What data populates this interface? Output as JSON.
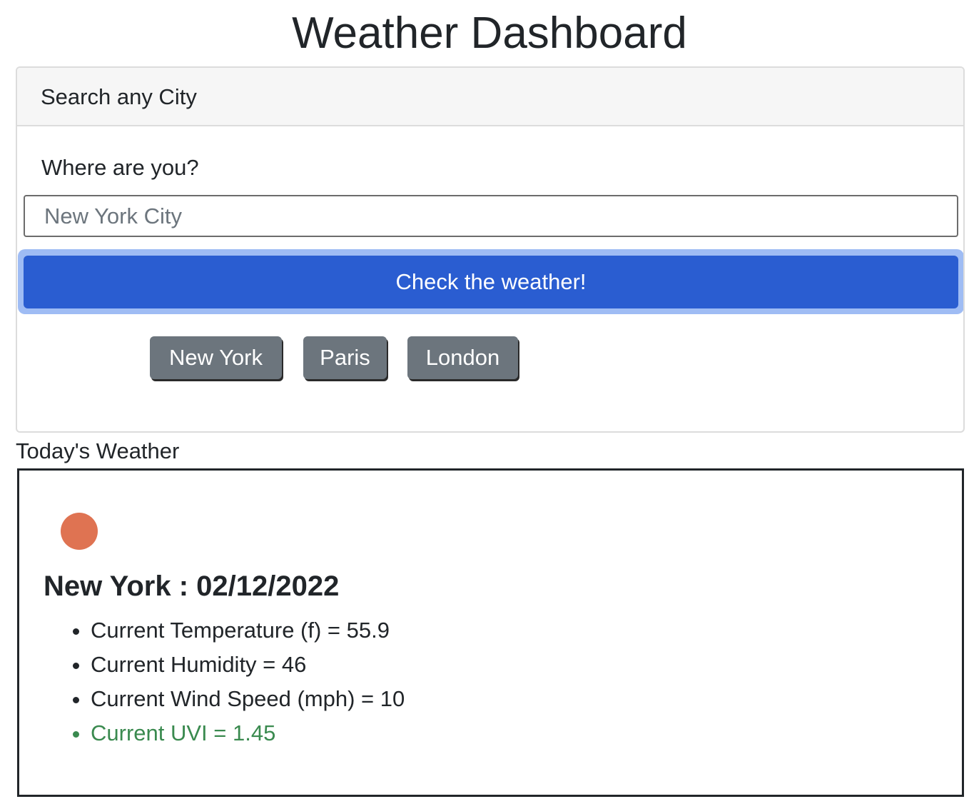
{
  "header": {
    "title": "Weather Dashboard"
  },
  "search": {
    "card_title": "Search any City",
    "label": "Where are you?",
    "placeholder": "New York City",
    "button_label": "Check the weather!",
    "quick_cities": [
      "New York",
      "Paris",
      "London"
    ]
  },
  "today": {
    "section_title": "Today's Weather",
    "icon": "weather-sun-icon",
    "icon_color": "#df7352",
    "heading": "New York : 02/12/2022",
    "items": [
      "Current Temperature (f) = 55.9",
      "Current Humidity = 46",
      "Current Wind Speed (mph) = 10",
      "Current UVI = 1.45"
    ],
    "uvi_color": "#3a8a4f"
  },
  "colors": {
    "primary": "#2a5dd1",
    "secondary": "#6c757d",
    "focus_ring": "#9fbcf4"
  }
}
